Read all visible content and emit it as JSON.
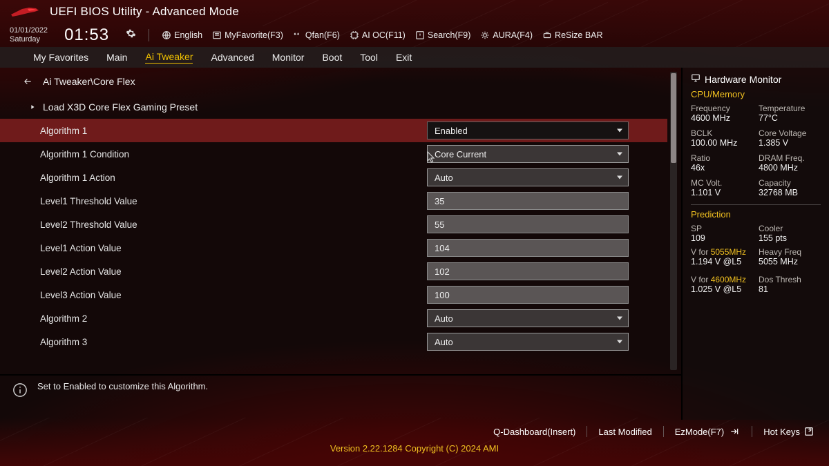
{
  "header": {
    "title": "UEFI BIOS Utility - Advanced Mode"
  },
  "datetime": {
    "date": "01/01/2022",
    "day": "Saturday",
    "time": "01:53"
  },
  "quick": {
    "language": "English",
    "myfavorite": "MyFavorite(F3)",
    "qfan": "Qfan(F6)",
    "aioc": "AI OC(F11)",
    "search": "Search(F9)",
    "aura": "AURA(F4)",
    "resize": "ReSize BAR"
  },
  "tabs": [
    "My Favorites",
    "Main",
    "Ai Tweaker",
    "Advanced",
    "Monitor",
    "Boot",
    "Tool",
    "Exit"
  ],
  "active_tab": "Ai Tweaker",
  "breadcrumb": "Ai Tweaker\\Core Flex",
  "subheading": "Load X3D Core Flex Gaming Preset",
  "rows": [
    {
      "label": "Algorithm 1",
      "type": "dropdown",
      "value": "Enabled",
      "selected": true,
      "dark": true
    },
    {
      "label": "Algorithm 1 Condition",
      "type": "dropdown",
      "value": "Core Current"
    },
    {
      "label": "Algorithm 1 Action",
      "type": "dropdown",
      "value": "Auto"
    },
    {
      "label": "Level1 Threshold Value",
      "type": "text",
      "value": "35"
    },
    {
      "label": "Level2 Threshold Value",
      "type": "text",
      "value": "55"
    },
    {
      "label": "Level1 Action Value",
      "type": "text",
      "value": "104"
    },
    {
      "label": "Level2 Action Value",
      "type": "text",
      "value": "102"
    },
    {
      "label": "Level3 Action Value",
      "type": "text",
      "value": "100"
    },
    {
      "label": "Algorithm 2",
      "type": "dropdown",
      "value": "Auto"
    },
    {
      "label": "Algorithm 3",
      "type": "dropdown",
      "value": "Auto"
    }
  ],
  "help": "Set to Enabled to customize this Algorithm.",
  "sidebar": {
    "title": "Hardware Monitor",
    "section1": "CPU/Memory",
    "grid1": [
      {
        "l": "Frequency",
        "v": "4600 MHz"
      },
      {
        "l": "Temperature",
        "v": "77°C"
      },
      {
        "l": "BCLK",
        "v": "100.00 MHz"
      },
      {
        "l": "Core Voltage",
        "v": "1.385 V"
      },
      {
        "l": "Ratio",
        "v": "46x"
      },
      {
        "l": "DRAM Freq.",
        "v": "4800 MHz"
      },
      {
        "l": "MC Volt.",
        "v": "1.101 V"
      },
      {
        "l": "Capacity",
        "v": "32768 MB"
      }
    ],
    "section2": "Prediction",
    "grid2": [
      {
        "l": "SP",
        "v": "109"
      },
      {
        "l": "Cooler",
        "v": "155 pts"
      }
    ],
    "pred": [
      {
        "line_pre": "V for ",
        "line_hi": "5055MHz",
        "sub": "1.194 V @L5",
        "r_l": "Heavy Freq",
        "r_v": "5055 MHz"
      },
      {
        "line_pre": "V for ",
        "line_hi": "4600MHz",
        "sub": "1.025 V @L5",
        "r_l": "Dos Thresh",
        "r_v": "81"
      }
    ]
  },
  "footer": {
    "qd": "Q-Dashboard(Insert)",
    "last": "Last Modified",
    "ez": "EzMode(F7)",
    "hot": "Hot Keys",
    "version": "Version 2.22.1284 Copyright (C) 2024 AMI"
  }
}
